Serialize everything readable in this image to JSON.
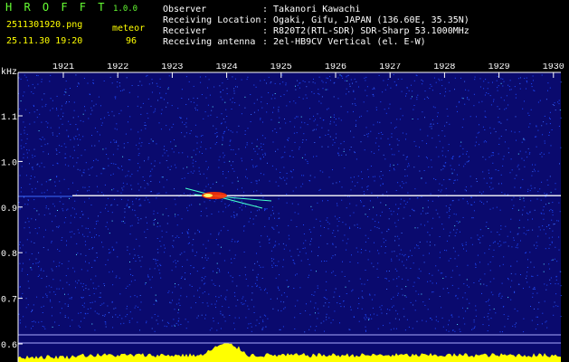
{
  "header": {
    "app_name": "H R O F F T",
    "app_version": "1.0.0",
    "file_name": "2511301920.png",
    "detection_label": "meteor",
    "date_time": "25.11.30 19:20",
    "meteor_count": "96",
    "info_rows": [
      {
        "label": "Observer",
        "value": ": Takanori Kawachi"
      },
      {
        "label": "Receiving Location",
        "value": ": Ogaki, Gifu, JAPAN (136.60E, 35.35N)"
      },
      {
        "label": "Receiver",
        "value": ": R820T2(RTL-SDR) SDR-Sharp 53.1000MHz"
      },
      {
        "label": "Receiving antenna",
        "value": ": 2el-HB9CV Vertical (el. E-W)"
      }
    ]
  },
  "chart_data": {
    "type": "heatmap",
    "ylabel": "kHz",
    "x_ticks": [
      "1921",
      "1922",
      "1923",
      "1924",
      "1925",
      "1926",
      "1927",
      "1928",
      "1929",
      "1930"
    ],
    "y_ticks": [
      "1.1",
      "1.0",
      "0.9",
      "0.8",
      "0.7",
      "0.6"
    ],
    "carrier_khz": 0.925,
    "meteor_event": {
      "time": "1924",
      "freq_khz": 0.92
    },
    "colors": {
      "background": "#0a0a6e",
      "carrier": "#ffffff",
      "noise": "#1e4bff",
      "meteor": "#ff3300",
      "power": "#ffff00",
      "axis": "#ffffff"
    }
  }
}
